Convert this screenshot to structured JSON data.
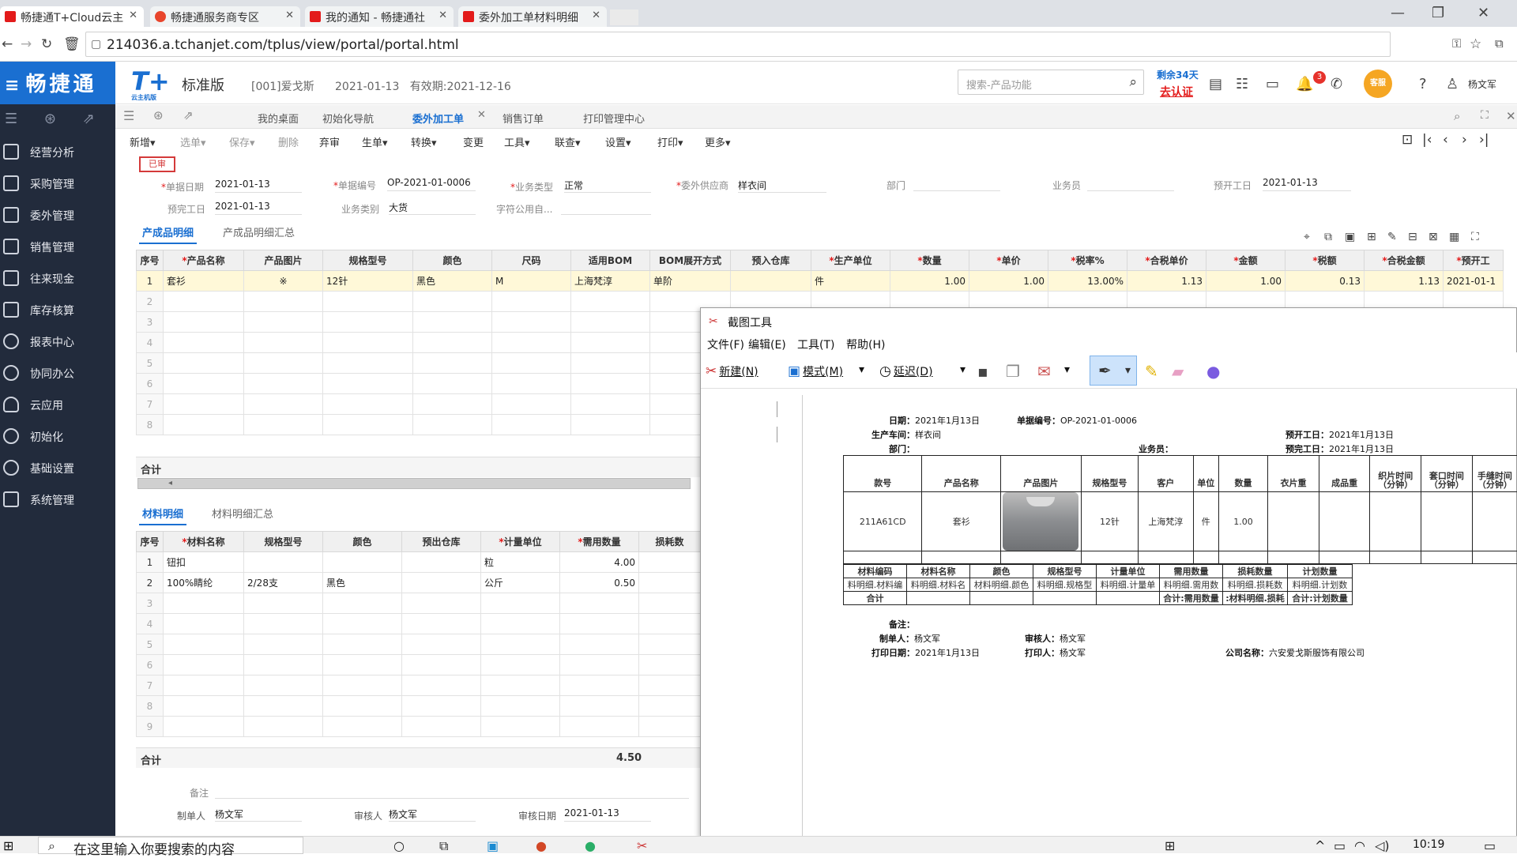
{
  "browser": {
    "tabs": [
      {
        "label": "畅捷通T+Cloud云主",
        "active": true,
        "favicon_color": "#e31b1b"
      },
      {
        "label": "畅捷通服务商专区",
        "active": false,
        "favicon_color": "#e8452c"
      },
      {
        "label": "我的通知 - 畅捷通社",
        "active": false,
        "favicon_color": "#e31b1b"
      },
      {
        "label": "委外加工单材料明细",
        "active": false,
        "favicon_color": "#e31b1b"
      }
    ],
    "url": "214036.a.tchanjet.com/tplus/view/portal/portal.html"
  },
  "brand": "畅捷通",
  "leftnav": {
    "items": [
      {
        "label": "经营分析"
      },
      {
        "label": "采购管理"
      },
      {
        "label": "委外管理"
      },
      {
        "label": "销售管理"
      },
      {
        "label": "往来现金"
      },
      {
        "label": "库存核算"
      },
      {
        "label": "报表中心"
      },
      {
        "label": "协同办公"
      },
      {
        "label": "云应用"
      },
      {
        "label": "初始化"
      },
      {
        "label": "基础设置"
      },
      {
        "label": "系统管理"
      }
    ]
  },
  "header": {
    "logo": "T+",
    "logo_sub": "云主机版",
    "edition": "标准版",
    "company": "[001]爱戈斯",
    "date": "2021-01-13",
    "validity": "有效期:2021-12-16",
    "search_placeholder": "搜索-产品功能",
    "trial": "剩余34天",
    "auth": "去认证",
    "notif_count": "3",
    "kefu": "客服",
    "user": "杨文军"
  },
  "pagetabs": [
    {
      "label": "我的桌面"
    },
    {
      "label": "初始化导航"
    },
    {
      "label": "委外加工单"
    },
    {
      "label": "销售订单"
    },
    {
      "label": "打印管理中心"
    }
  ],
  "toolbar": {
    "items": [
      {
        "label": "新增▾"
      },
      {
        "label": "选单▾"
      },
      {
        "label": "保存▾"
      },
      {
        "label": "删除"
      },
      {
        "label": "弃审"
      },
      {
        "label": "生单▾"
      },
      {
        "label": "转换▾"
      },
      {
        "label": "变更"
      },
      {
        "label": "工具▾"
      },
      {
        "label": "联查▾"
      },
      {
        "label": "设置▾"
      },
      {
        "label": "打印▾"
      },
      {
        "label": "更多▾"
      }
    ]
  },
  "form": {
    "status": "已审",
    "fields": [
      {
        "label": "单据日期",
        "value": "2021-01-13"
      },
      {
        "label": "单据编号",
        "value": "OP-2021-01-0006"
      },
      {
        "label": "业务类型",
        "value": "正常"
      },
      {
        "label": "委外供应商",
        "value": "样衣间"
      },
      {
        "label": "部门",
        "value": ""
      },
      {
        "label": "业务员",
        "value": ""
      },
      {
        "label": "预开工日",
        "value": "2021-01-13"
      },
      {
        "label": "预完工日",
        "value": "2021-01-13"
      },
      {
        "label": "业务类别",
        "value": "大货"
      },
      {
        "label": "字符公用自...",
        "value": ""
      }
    ]
  },
  "product_section": {
    "tabs": [
      "产成品明细",
      "产成品明细汇总"
    ],
    "columns": [
      "序号",
      "产品名称",
      "产品图片",
      "规格型号",
      "颜色",
      "尺码",
      "适用BOM",
      "BOM展开方式",
      "预入仓库",
      "生产单位",
      "数量",
      "单价",
      "税率%",
      "合税单价",
      "金额",
      "税额",
      "合税金额",
      "预开工"
    ],
    "rows": [
      [
        "1",
        "套衫",
        "※",
        "12针",
        "黑色",
        "M",
        "上海梵淳",
        "单阶",
        "",
        "件",
        "1.00",
        "1.00",
        "13.00%",
        "1.13",
        "1.00",
        "0.13",
        "1.13",
        "2021-01-1"
      ]
    ],
    "row_numbers": [
      "2",
      "3",
      "4",
      "5",
      "6",
      "7",
      "8"
    ],
    "sum_label": "合计"
  },
  "material_section": {
    "tabs": [
      "材料明细",
      "材料明细汇总"
    ],
    "columns": [
      "序号",
      "材料名称",
      "规格型号",
      "颜色",
      "预出仓库",
      "计量单位",
      "需用数量",
      "损耗数"
    ],
    "rows": [
      [
        "1",
        "钮扣",
        "",
        "",
        "",
        "粒",
        "4.00",
        ""
      ],
      [
        "2",
        "100%睛纶",
        "2/28支",
        "黑色",
        "",
        "公斤",
        "0.50",
        ""
      ]
    ],
    "row_numbers": [
      "3",
      "4",
      "5",
      "6",
      "7",
      "8",
      "9"
    ],
    "sum_label": "合计",
    "sum_value": "4.50"
  },
  "footer": {
    "remark_label": "备注",
    "maker_label": "制单人",
    "maker": "杨文军",
    "auditor_label": "审核人",
    "auditor": "杨文军",
    "audit_date_label": "审核日期",
    "audit_date": "2021-01-13"
  },
  "snip": {
    "title": "截图工具",
    "menus": [
      "文件(F)",
      "编辑(E)",
      "工具(T)",
      "帮助(H)"
    ],
    "new_label": "新建(N)",
    "mode_label": "模式(M)",
    "delay_label": "延迟(D)"
  },
  "preview": {
    "date_label": "日期：",
    "date": "2021年1月13日",
    "docno_label": "单据编号：",
    "docno": "OP-2021-01-0006",
    "workshop_label": "生产车间：",
    "workshop": "样衣间",
    "start_label": "预开工日：",
    "start": "2021年1月13日",
    "dept_label": "部门：",
    "sales_label": "业务员：",
    "finish_label": "预完工日：",
    "finish": "2021年1月13日",
    "product_headers": [
      "款号",
      "产品名称",
      "产品图片",
      "规格型号",
      "客户",
      "单位",
      "数量",
      "衣片重",
      "成品重",
      "织片时间（分钟）",
      "套口时间（分钟）",
      "手缝时间（分钟）"
    ],
    "product_row": [
      "211A61CD",
      "套衫",
      "",
      "12针",
      "上海梵淳",
      "件",
      "1.00",
      "",
      "",
      "",
      "",
      ""
    ],
    "material_headers": [
      "材料编码",
      "材料名称",
      "颜色",
      "规格型号",
      "计量单位",
      "需用数量",
      "损耗数量",
      "计划数量"
    ],
    "material_row": [
      "料明细.材料编",
      "料明细.材料名",
      "材料明细.颜色",
      "料明细.规格型",
      "料明细.计量单",
      "料明细.需用数",
      "料明细.损耗数",
      "料明细.计划数"
    ],
    "sum_label": "合计",
    "sum_row": [
      "合计:需用数量",
      ":材料明细.损耗",
      "合计:计划数量"
    ],
    "remark_label": "备注：",
    "maker_label": "制单人：",
    "maker": "杨文军",
    "auditor_label": "审核人：",
    "auditor": "杨文军",
    "printdate_label": "打印日期：",
    "printdate": "2021年1月13日",
    "printer_label": "打印人：",
    "printer": "杨文军",
    "company_label": "公司名称：",
    "company": "六安爱戈斯服饰有限公司"
  },
  "taskbar": {
    "search_placeholder": "在这里输入你要搜索的内容",
    "clock": "10:19"
  },
  "colors": {
    "brand_blue": "#1a6fd1",
    "nav_bg": "#222b3c",
    "alert_red": "#e31b1b"
  }
}
